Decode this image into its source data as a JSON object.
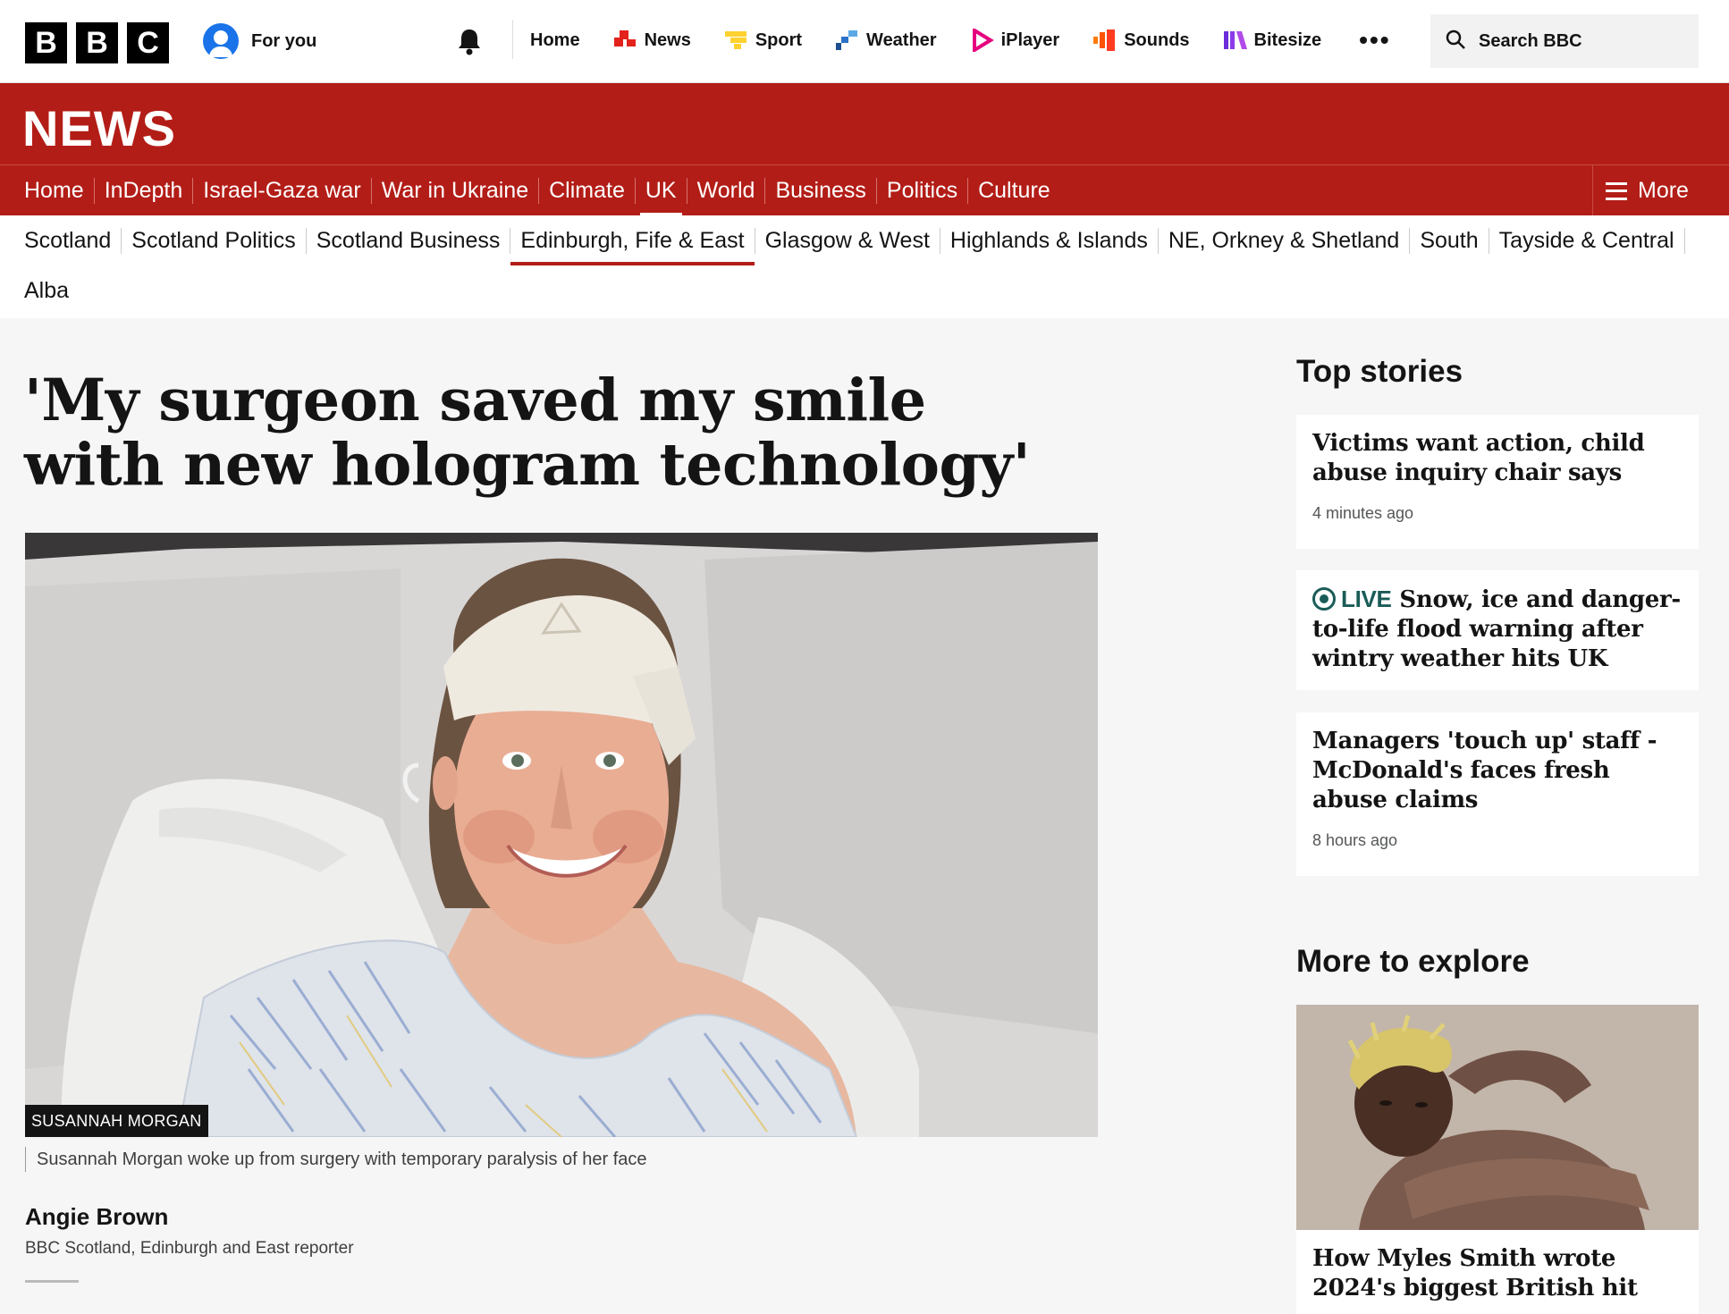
{
  "masthead": {
    "logo_letters": [
      "B",
      "B",
      "C"
    ],
    "for_you_label": "For you",
    "nav_items": [
      {
        "label": "Home",
        "icon": "none"
      },
      {
        "label": "News",
        "icon": "news-icon"
      },
      {
        "label": "Sport",
        "icon": "sport-icon"
      },
      {
        "label": "Weather",
        "icon": "weather-icon"
      },
      {
        "label": "iPlayer",
        "icon": "iplayer-icon"
      },
      {
        "label": "Sounds",
        "icon": "sounds-icon"
      },
      {
        "label": "Bitesize",
        "icon": "bitesize-icon"
      }
    ],
    "more_dots": "•••",
    "search_label": "Search BBC"
  },
  "news_banner": {
    "title": "NEWS"
  },
  "section_nav": {
    "items": [
      "Home",
      "InDepth",
      "Israel-Gaza war",
      "War in Ukraine",
      "Climate",
      "UK",
      "World",
      "Business",
      "Politics",
      "Culture"
    ],
    "active": "UK",
    "more_label": "More"
  },
  "sub_nav": {
    "items": [
      "Scotland",
      "Scotland Politics",
      "Scotland Business",
      "Edinburgh, Fife & East",
      "Glasgow & West",
      "Highlands & Islands",
      "NE, Orkney & Shetland",
      "South",
      "Tayside & Central",
      "Alba"
    ],
    "active": "Edinburgh, Fife & East"
  },
  "article": {
    "headline": "'My surgeon saved my smile with new hologram technology'",
    "image_credit": "SUSANNAH MORGAN",
    "image_caption": "Susannah Morgan woke up from surgery with temporary paralysis of her face",
    "author_name": "Angie Brown",
    "author_role": "BBC Scotland, Edinburgh and East reporter"
  },
  "sidebar": {
    "top_stories_heading": "Top stories",
    "stories": [
      {
        "title": "Victims want action, child abuse inquiry chair says",
        "meta": "4 minutes ago",
        "live": ""
      },
      {
        "title": "Snow, ice and danger-to-life flood warning after wintry weather hits UK",
        "meta": "",
        "live": "LIVE"
      },
      {
        "title": "Managers 'touch up' staff - McDonald's faces fresh abuse claims",
        "meta": "8 hours ago",
        "live": ""
      }
    ],
    "more_to_explore_heading": "More to explore",
    "explore_title": "How Myles Smith wrote 2024's biggest British hit"
  },
  "colors": {
    "news_red": "#b31d17",
    "live_teal": "#1a5c57",
    "text_dark": "#141414"
  }
}
